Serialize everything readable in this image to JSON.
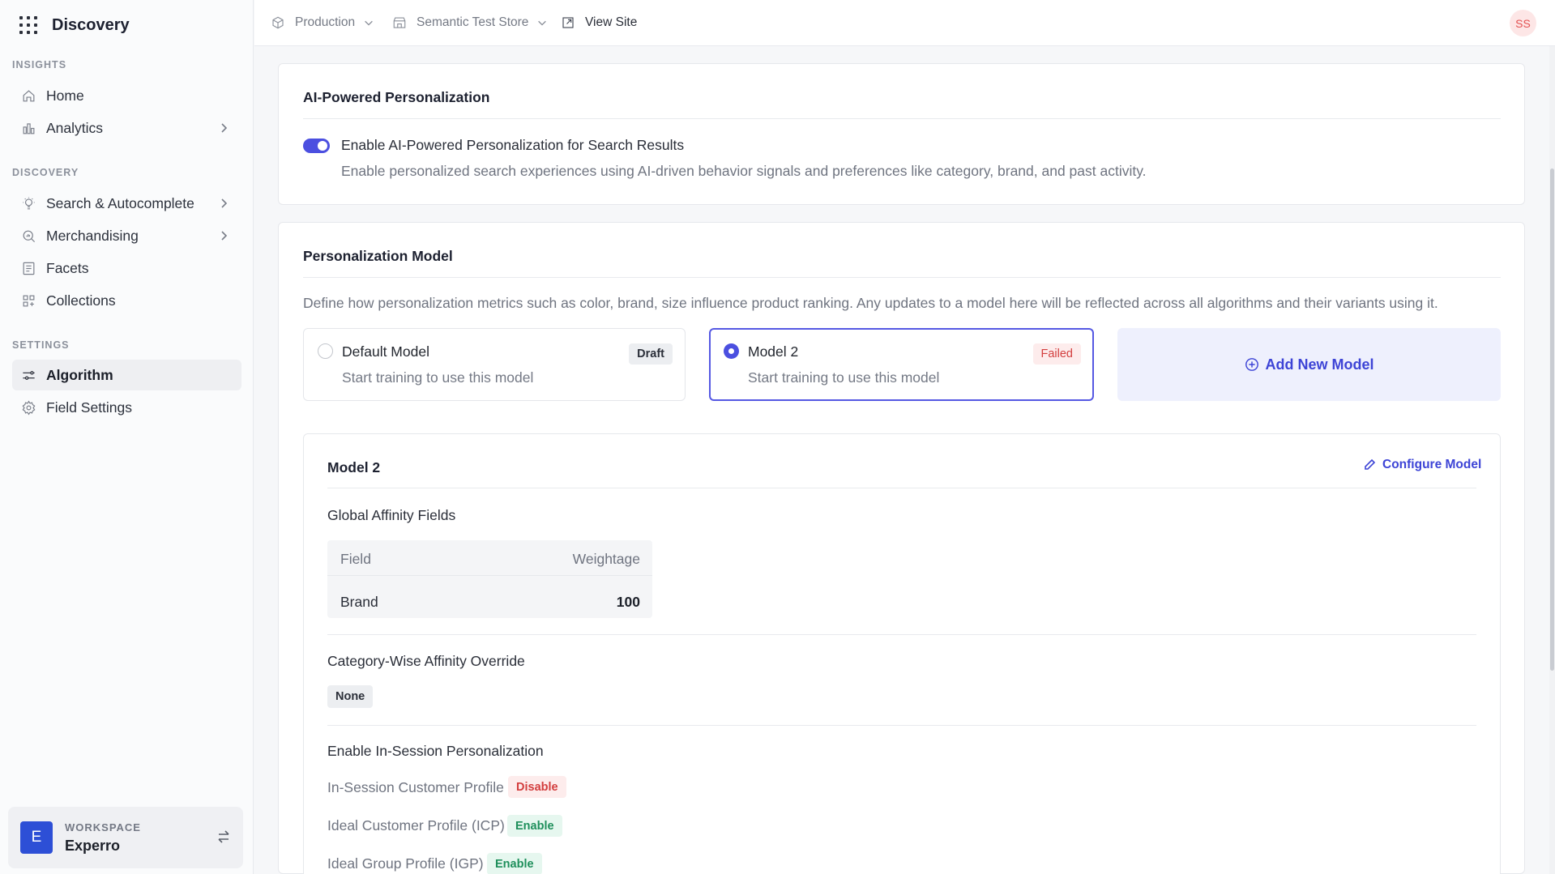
{
  "app": {
    "title": "Discovery"
  },
  "sidebar": {
    "sections": [
      {
        "label": "INSIGHTS"
      },
      {
        "label": "DISCOVERY"
      },
      {
        "label": "SETTINGS"
      }
    ],
    "items": [
      {
        "label": "Home",
        "icon": "home-icon"
      },
      {
        "label": "Analytics",
        "icon": "analytics-icon"
      },
      {
        "label": "Search & Autocomplete",
        "icon": "bulb-icon"
      },
      {
        "label": "Merchandising",
        "icon": "merch-search-icon"
      },
      {
        "label": "Facets",
        "icon": "facets-icon"
      },
      {
        "label": "Collections",
        "icon": "collections-icon"
      },
      {
        "label": "Algorithm",
        "icon": "sliders-icon"
      },
      {
        "label": "Field Settings",
        "icon": "gear-icon"
      }
    ],
    "workspace": {
      "label": "WORKSPACE",
      "name": "Experro",
      "avatar": "E"
    }
  },
  "topbar": {
    "environment": "Production",
    "store": "Semantic Test Store",
    "view_site": "View Site",
    "user_initials": "SS"
  },
  "personalization": {
    "title": "AI-Powered Personalization",
    "toggle_enabled": true,
    "toggle_label": "Enable AI-Powered Personalization for Search Results",
    "toggle_desc": "Enable personalized search experiences using AI-driven behavior signals and preferences like category, brand, and past activity."
  },
  "model_section": {
    "title": "Personalization Model",
    "desc": "Define how personalization metrics such as color, brand, size influence product ranking. Any updates to a model here will be reflected across all algorithms and their variants using it.",
    "models": [
      {
        "name": "Default Model",
        "desc": "Start training to use this model",
        "status": "Draft",
        "selected": false
      },
      {
        "name": "Model 2",
        "desc": "Start training to use this model",
        "status": "Failed",
        "selected": true
      }
    ],
    "add_model": "Add New Model"
  },
  "model_detail": {
    "title": "Model 2",
    "configure": "Configure Model",
    "global_affinity_title": "Global Affinity Fields",
    "table": {
      "headers": [
        "Field",
        "Weightage"
      ],
      "rows": [
        [
          "Brand",
          "100"
        ]
      ]
    },
    "category_override_title": "Category-Wise Affinity Override",
    "category_override_value": "None",
    "in_session_title": "Enable In-Session Personalization",
    "in_session_items": [
      {
        "label": "In-Session Customer Profile",
        "status": "Disable"
      },
      {
        "label": "Ideal Customer Profile (ICP)",
        "status": "Enable"
      },
      {
        "label": "Ideal Group Profile (IGP)",
        "status": "Enable"
      }
    ]
  },
  "colors": {
    "accent": "#4b4fe0",
    "failed": "#d33e3e",
    "enable": "#1e8f5b"
  }
}
